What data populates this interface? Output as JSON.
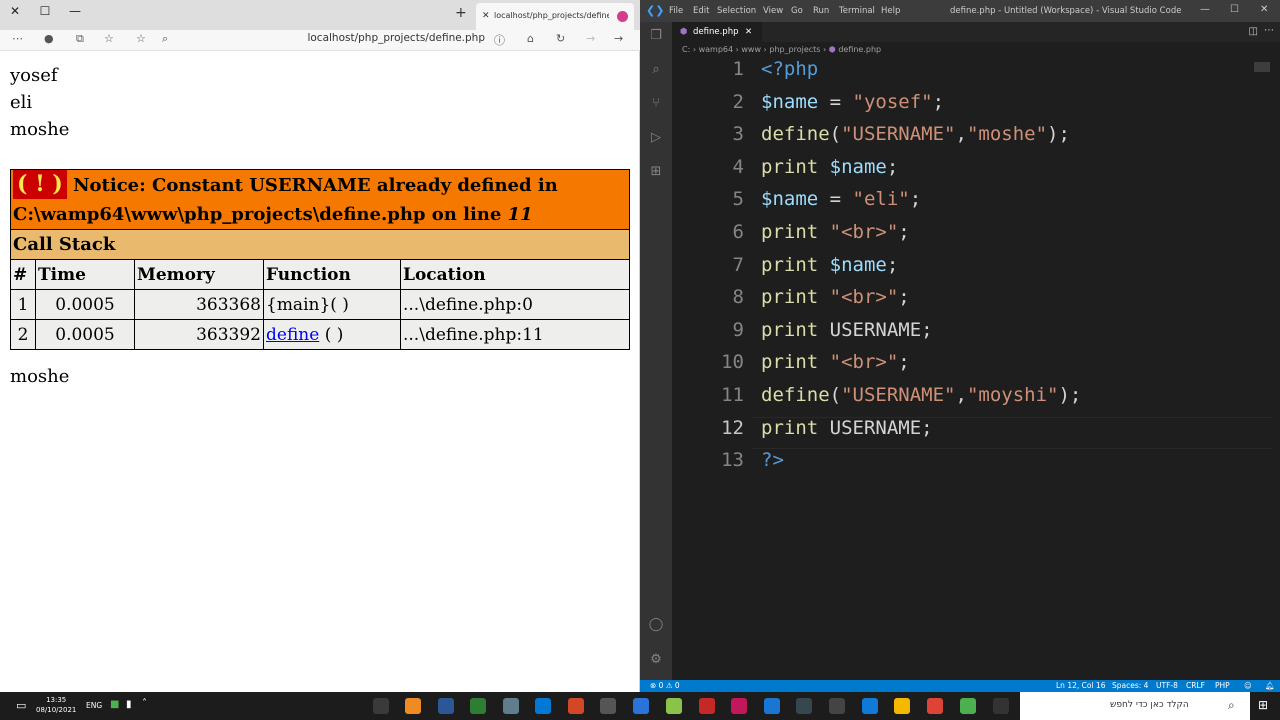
{
  "browser": {
    "tab_title": "localhost/php_projects/define.php",
    "address": "localhost/php_projects/define.php",
    "output_lines": [
      "yosef",
      "eli",
      "moshe"
    ],
    "notice": {
      "bang": "( ! )",
      "text": "Notice: Constant USERNAME already defined in C:\\wamp64\\www\\php_projects\\define.php on line",
      "line": "11"
    },
    "call_stack_label": "Call Stack",
    "columns": [
      "#",
      "Time",
      "Memory",
      "Function",
      "Location"
    ],
    "rows": [
      {
        "n": "1",
        "time": "0.0005",
        "memory": "363368",
        "function": "{main}( )",
        "location": "...\\define.php:0"
      },
      {
        "n": "2",
        "time": "0.0005",
        "memory": "363392",
        "function_link": "define",
        "function_rest": " ( )",
        "location": "...\\define.php:11"
      }
    ],
    "after_output": "moshe"
  },
  "vscode": {
    "menu": [
      "File",
      "Edit",
      "Selection",
      "View",
      "Go",
      "Run",
      "Terminal",
      "Help"
    ],
    "title": "define.php - Untitled (Workspace) - Visual Studio Code",
    "tab": "define.php",
    "breadcrumb": [
      "C:",
      "wamp64",
      "www",
      "php_projects",
      "define.php"
    ],
    "line_numbers": [
      "1",
      "2",
      "3",
      "4",
      "5",
      "6",
      "7",
      "8",
      "9",
      "10",
      "11",
      "12",
      "13"
    ],
    "code": [
      [
        [
          "k-tag",
          "<?php"
        ]
      ],
      [
        [
          "k-var",
          "$name"
        ],
        [
          "k-op",
          " = "
        ],
        [
          "k-str",
          "\"yosef\""
        ],
        [
          "k-op",
          ";"
        ]
      ],
      [
        [
          "k-fn",
          "define"
        ],
        [
          "k-op",
          "("
        ],
        [
          "k-str",
          "\"USERNAME\""
        ],
        [
          "k-op",
          ","
        ],
        [
          "k-str",
          "\"moshe\""
        ],
        [
          "k-op",
          ");"
        ]
      ],
      [
        [
          "k-fn",
          "print"
        ],
        [
          "k-op",
          " "
        ],
        [
          "k-var",
          "$name"
        ],
        [
          "k-op",
          ";"
        ]
      ],
      [
        [
          "k-var",
          "$name"
        ],
        [
          "k-op",
          " = "
        ],
        [
          "k-str",
          "\"eli\""
        ],
        [
          "k-op",
          ";"
        ]
      ],
      [
        [
          "k-fn",
          "print"
        ],
        [
          "k-op",
          " "
        ],
        [
          "k-str",
          "\"<br>\""
        ],
        [
          "k-op",
          ";"
        ]
      ],
      [
        [
          "k-fn",
          "print"
        ],
        [
          "k-op",
          " "
        ],
        [
          "k-var",
          "$name"
        ],
        [
          "k-op",
          ";"
        ]
      ],
      [
        [
          "k-fn",
          "print"
        ],
        [
          "k-op",
          " "
        ],
        [
          "k-str",
          "\"<br>\""
        ],
        [
          "k-op",
          ";"
        ]
      ],
      [
        [
          "k-fn",
          "print"
        ],
        [
          "k-op",
          " USERNAME;"
        ]
      ],
      [
        [
          "k-fn",
          "print"
        ],
        [
          "k-op",
          " "
        ],
        [
          "k-str",
          "\"<br>\""
        ],
        [
          "k-op",
          ";"
        ]
      ],
      [
        [
          "k-fn",
          "define"
        ],
        [
          "k-op",
          "("
        ],
        [
          "k-str",
          "\"USERNAME\""
        ],
        [
          "k-op",
          ","
        ],
        [
          "k-str",
          "\"moyshi\""
        ],
        [
          "k-op",
          ");"
        ]
      ],
      [
        [
          "k-fn",
          "print"
        ],
        [
          "k-op",
          " USERNAME;"
        ]
      ],
      [
        [
          "k-tag",
          "?>"
        ]
      ]
    ],
    "active_line": "12",
    "status": {
      "problems": "⊗ 0 ⚠ 0",
      "position": "Ln 12, Col 16",
      "spaces": "Spaces: 4",
      "encoding": "UTF-8",
      "eol": "CRLF",
      "language": "PHP"
    }
  },
  "taskbar": {
    "time": "13:35",
    "date": "08/10/2021",
    "lang": "ENG",
    "search_placeholder": "הקלד כאן כדי לחפש"
  }
}
